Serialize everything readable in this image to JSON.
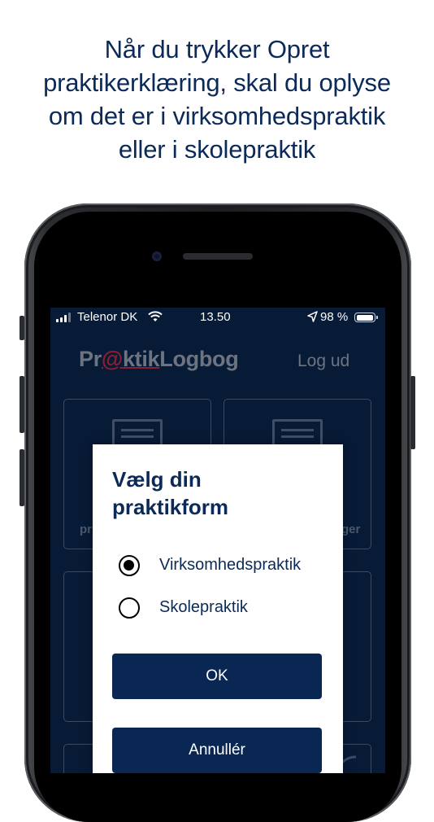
{
  "headline": {
    "line1": "Når du trykker Opret",
    "line2": "praktikerklæring, skal du oplyse",
    "line3": "om det er i virksomhedspraktik",
    "line4": "eller i skolepraktik"
  },
  "status_bar": {
    "carrier": "Telenor DK",
    "time": "13.50",
    "battery": "98 %"
  },
  "app": {
    "logo_pre": "Pr",
    "logo_at": "@",
    "logo_ul": "ktik",
    "logo_post": "Logbog",
    "logout": "Log ud",
    "tile1_label_partial": "pr",
    "tile2_label_partial": "ger"
  },
  "dialog": {
    "title": "Vælg din praktikform",
    "options": [
      {
        "label": "Virksomhedspraktik",
        "selected": true
      },
      {
        "label": "Skolepraktik",
        "selected": false
      }
    ],
    "ok_label": "OK",
    "cancel_label": "Annullér"
  },
  "colors": {
    "headline": "#0c2a57",
    "screen_background": "#071a36",
    "button": "#0a2754",
    "logo_accent": "#8b1f31"
  }
}
